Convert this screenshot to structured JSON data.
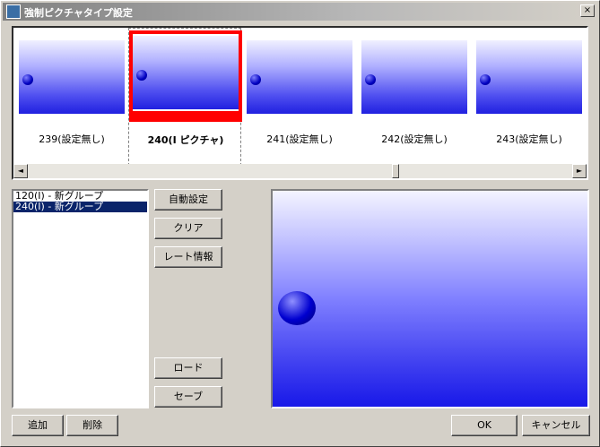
{
  "window": {
    "title": "強制ピクチャタイプ設定",
    "close_glyph": "×"
  },
  "thumbnails": [
    {
      "label": "239(設定無し)",
      "selected": false
    },
    {
      "label": "240(I ピクチャ)",
      "selected": true
    },
    {
      "label": "241(設定無し)",
      "selected": false
    },
    {
      "label": "242(設定無し)",
      "selected": false
    },
    {
      "label": "243(設定無し)",
      "selected": false
    }
  ],
  "scrollbar": {
    "left_arrow": "◄",
    "right_arrow": "►"
  },
  "list": {
    "items": [
      {
        "label": "120(I) - 新グループ",
        "selected": false
      },
      {
        "label": "240(I) - 新グループ",
        "selected": true
      }
    ]
  },
  "buttons": {
    "auto": "自動設定",
    "clear": "クリア",
    "rate_info": "レート情報",
    "load": "ロード",
    "save": "セーブ",
    "add": "追加",
    "delete": "削除",
    "ok": "OK",
    "cancel": "キャンセル"
  },
  "colors": {
    "selection_frame": "#ff0000",
    "list_selection": "#0a246a"
  }
}
